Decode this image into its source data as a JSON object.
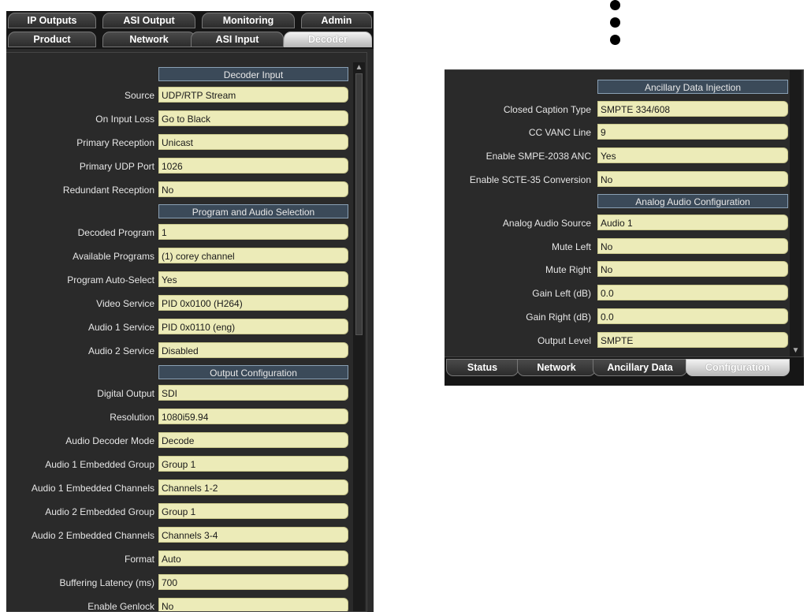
{
  "left_panel": {
    "tabs_row1": [
      "IP Outputs",
      "ASI Output",
      "Monitoring",
      "Admin"
    ],
    "tabs_row2": [
      "Product",
      "Network",
      "ASI Input",
      "Decoder"
    ],
    "active_tab": "Decoder",
    "sections": {
      "decoder_input": "Decoder Input",
      "program_audio": "Program and Audio Selection",
      "output_config": "Output Configuration"
    },
    "fields": [
      {
        "label": "Source",
        "value": "UDP/RTP Stream"
      },
      {
        "label": "On Input Loss",
        "value": "Go to Black"
      },
      {
        "label": "Primary Reception",
        "value": "Unicast"
      },
      {
        "label": "Primary UDP Port",
        "value": "1026"
      },
      {
        "label": "Redundant Reception",
        "value": "No"
      },
      {
        "label": "Decoded Program",
        "value": "1"
      },
      {
        "label": "Available Programs",
        "value": "(1) corey channel"
      },
      {
        "label": "Program Auto-Select",
        "value": "Yes"
      },
      {
        "label": "Video Service",
        "value": "PID 0x0100 (H264)"
      },
      {
        "label": "Audio 1 Service",
        "value": "PID 0x0110 (eng)"
      },
      {
        "label": "Audio 2 Service",
        "value": "Disabled"
      },
      {
        "label": "Digital Output",
        "value": "SDI"
      },
      {
        "label": "Resolution",
        "value": "1080i59.94"
      },
      {
        "label": "Audio Decoder Mode",
        "value": "Decode"
      },
      {
        "label": "Audio 1 Embedded Group",
        "value": "Group 1"
      },
      {
        "label": "Audio 1 Embedded Channels",
        "value": "Channels 1-2"
      },
      {
        "label": "Audio 2 Embedded Group",
        "value": "Group 1"
      },
      {
        "label": "Audio 2 Embedded Channels",
        "value": "Channels 3-4"
      },
      {
        "label": "Format",
        "value": "Auto"
      },
      {
        "label": "Buffering Latency (ms)",
        "value": "700"
      },
      {
        "label": "Enable Genlock",
        "value": "No"
      }
    ]
  },
  "right_panel": {
    "sections": {
      "ancillary": "Ancillary Data Injection",
      "analog_audio": "Analog Audio Configuration"
    },
    "fields": [
      {
        "label": "Closed Caption Type",
        "value": "SMPTE 334/608"
      },
      {
        "label": "CC VANC Line",
        "value": "9"
      },
      {
        "label": "Enable SMPE-2038 ANC",
        "value": "Yes"
      },
      {
        "label": "Enable SCTE-35 Conversion",
        "value": "No"
      },
      {
        "label": "Analog Audio Source",
        "value": "Audio 1"
      },
      {
        "label": "Mute Left",
        "value": "No"
      },
      {
        "label": "Mute Right",
        "value": "No"
      },
      {
        "label": "Gain Left (dB)",
        "value": "0.0"
      },
      {
        "label": "Gain Right (dB)",
        "value": "0.0"
      },
      {
        "label": "Output Level",
        "value": "SMPTE"
      }
    ],
    "tabs_bottom": [
      "Status",
      "Network",
      "Ancillary Data",
      "Configuration"
    ],
    "active_tab": "Configuration"
  },
  "colors": {
    "field_bg": "#ecebb8",
    "section_bg": "#3b4a59",
    "panel_bg": "#2a2a2a"
  }
}
